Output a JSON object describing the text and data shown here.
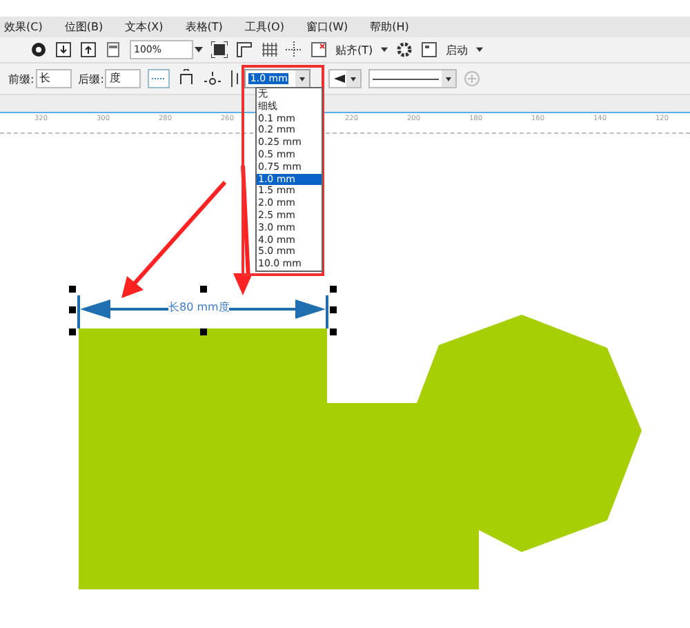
{
  "menu_bar": {
    "items": [
      "效果(C)",
      "位图(B)",
      "文本(X)",
      "表格(T)",
      "工具(O)",
      "窗口(W)",
      "帮助(H)"
    ]
  },
  "toolbar": {
    "zoom": "100%",
    "snap": "贴齐(T)",
    "launch": "启动"
  },
  "property_bar": {
    "prefix_label": "前缀:",
    "prefix_value": "长",
    "suffix_label": "后缀:",
    "suffix_value": "度",
    "outline_width": "1.0 mm"
  },
  "outline_dropdown": {
    "options": [
      {
        "label": "无",
        "selected": false
      },
      {
        "label": "细线",
        "selected": false
      },
      {
        "label": "0.1 mm",
        "selected": false
      },
      {
        "label": "0.2 mm",
        "selected": false
      },
      {
        "label": "0.25 mm",
        "selected": false
      },
      {
        "label": "0.5 mm",
        "selected": false
      },
      {
        "label": "0.75 mm",
        "selected": false
      },
      {
        "label": "1.0 mm",
        "selected": true
      },
      {
        "label": "1.5 mm",
        "selected": false
      },
      {
        "label": "2.0 mm",
        "selected": false
      },
      {
        "label": "2.5 mm",
        "selected": false
      },
      {
        "label": "3.0 mm",
        "selected": false
      },
      {
        "label": "4.0 mm",
        "selected": false
      },
      {
        "label": "5.0 mm",
        "selected": false
      },
      {
        "label": "10.0 mm",
        "selected": false
      }
    ]
  },
  "ruler": {
    "labels": [
      "320",
      "300",
      "280",
      "260",
      "220",
      "200",
      "180",
      "160",
      "140",
      "120"
    ]
  },
  "canvas": {
    "dimension_text": "长80 mm度"
  }
}
